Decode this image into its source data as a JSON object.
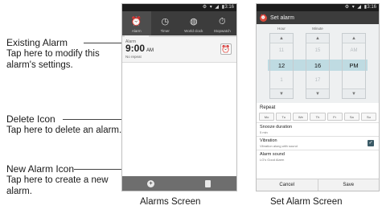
{
  "callouts": {
    "existing": {
      "title": "Existing Alarm",
      "desc": "Tap here to modify this alarm's settings."
    },
    "delete": {
      "title": "Delete Icon",
      "desc": "Tap here to delete an alarm."
    },
    "new_alarm": {
      "title": "New Alarm Icon",
      "desc": "Tap here to create a new alarm."
    }
  },
  "status_bar": {
    "icons": "⚙ ▾ ◢ ▮",
    "time": "3:16"
  },
  "alarms_screen": {
    "caption": "Alarms Screen",
    "tabs": [
      {
        "label": "Alarm",
        "icon": "alarm-clock-icon"
      },
      {
        "label": "Timer",
        "icon": "timer-icon"
      },
      {
        "label": "World clock",
        "icon": "globe-icon"
      },
      {
        "label": "Stopwatch",
        "icon": "stopwatch-icon"
      }
    ],
    "alarm": {
      "label": "Alarm",
      "time": "9:00",
      "ampm": "AM",
      "repeat": "No repeat"
    },
    "new_icon": "+",
    "delete_icon": "▮"
  },
  "set_alarm_screen": {
    "caption": "Set Alarm Screen",
    "title": "Set alarm",
    "picker": {
      "hour_label": "Hour",
      "minute_label": "Minute",
      "hour_prev": "11",
      "hour": "12",
      "hour_next": "1",
      "minute_prev": "15",
      "minute": "16",
      "minute_next": "17",
      "ampm_prev": "AM",
      "ampm": "PM"
    },
    "repeat_label": "Repeat",
    "days": [
      "Mo",
      "Tu",
      "We",
      "Th",
      "Fr",
      "Sa",
      "Su"
    ],
    "snooze": {
      "title": "Snooze duration",
      "sub": "5 min"
    },
    "vibration": {
      "title": "Vibration",
      "sub": "Vibration along with sound"
    },
    "sound": {
      "title": "Alarm sound",
      "sub": "LG's Good Alarm"
    },
    "cancel_label": "Cancel",
    "save_label": "Save"
  }
}
